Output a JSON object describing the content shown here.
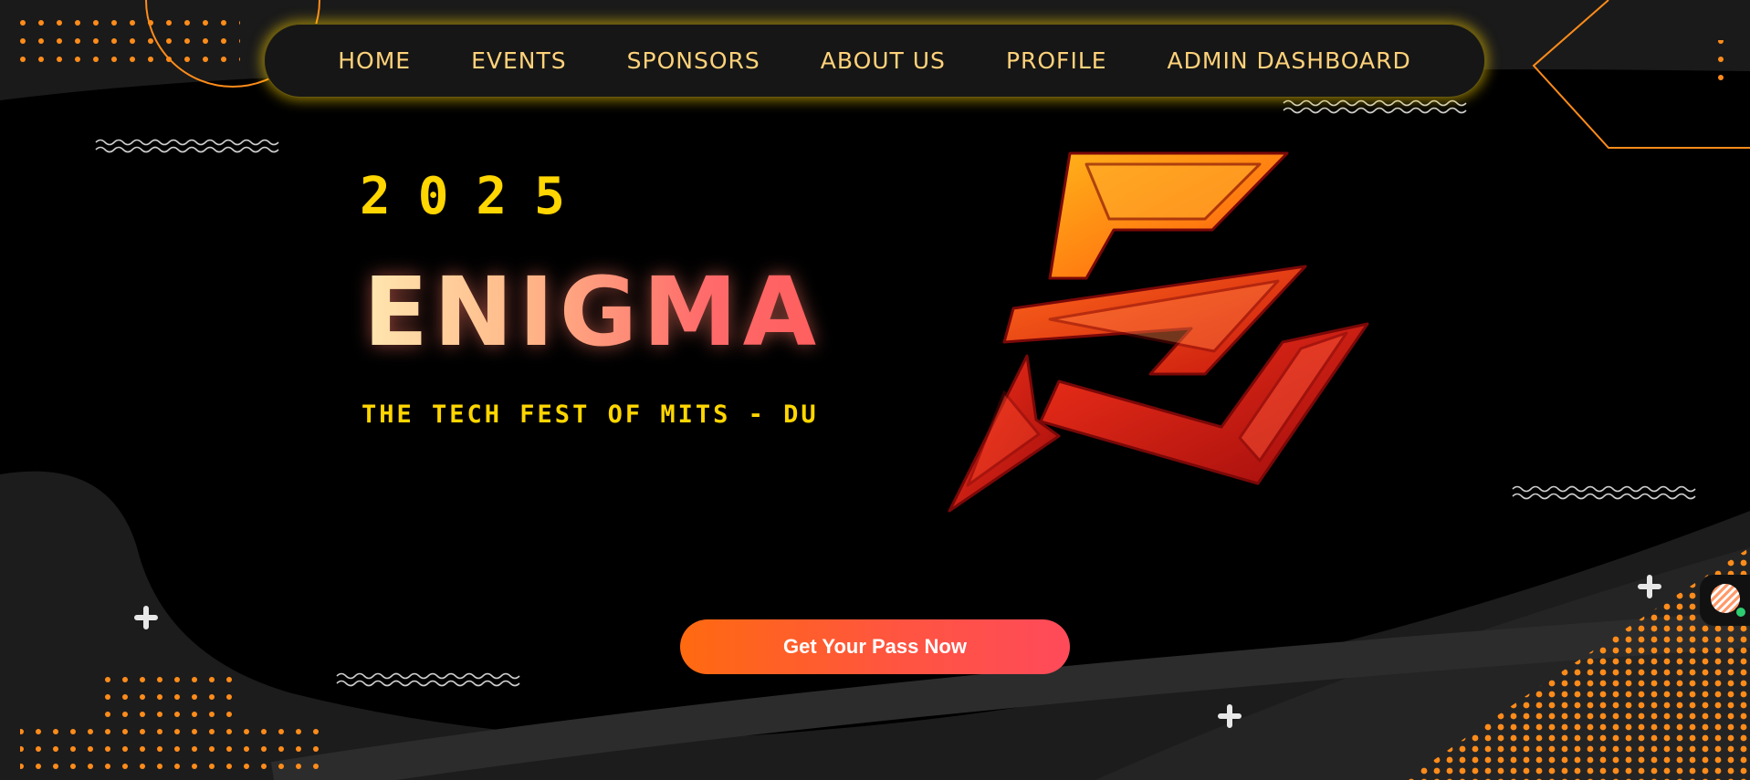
{
  "nav": {
    "items": [
      {
        "label": "HOME"
      },
      {
        "label": "EVENTS"
      },
      {
        "label": "SPONSORS"
      },
      {
        "label": "ABOUT US"
      },
      {
        "label": "PROFILE"
      },
      {
        "label": "ADMIN DASHBOARD"
      }
    ]
  },
  "hero": {
    "year": "2025",
    "title": "ENIGMA",
    "tagline": "THE TECH FEST OF MITS - DU",
    "cta_label": "Get Your Pass Now"
  },
  "logo": {
    "icon": "enigma-e-logo"
  },
  "chat_widget": {
    "icon": "chat-avatar-icon",
    "status_color": "#2ecc71"
  },
  "colors": {
    "background": "#000000",
    "accent_yellow": "#ffd600",
    "nav_text": "#ffd27a",
    "cta_start": "#ff6a10",
    "cta_end": "#ff4a5a",
    "dots": "#ff8c1a"
  }
}
